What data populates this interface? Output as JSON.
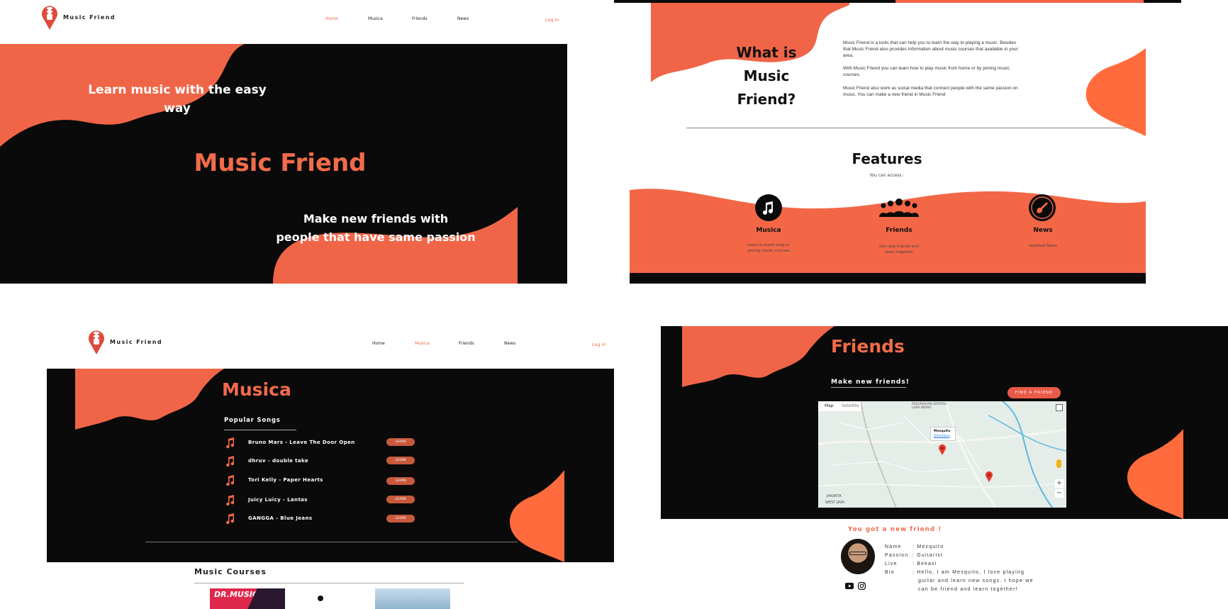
{
  "brand": {
    "name": "Music Friend"
  },
  "nav": {
    "home": "Home",
    "musica": "Musica",
    "friends": "Friends",
    "news": "News",
    "login": "Log In"
  },
  "hero": {
    "tagline1": "Learn music with the easy",
    "tagline1b": "way",
    "title": "Music Friend",
    "tagline2a": "Make new friends with",
    "tagline2b": "people that have same passion"
  },
  "about": {
    "heading_line1": "What is Music",
    "heading_line2": "Friend?",
    "p1": "Music Friend is a tools that can help you to learn the way to playing a music. Besides that Music Friend also provides information about music courses that available in your area.",
    "p2": "With Music Friend you can learn how to play music from home or by joining music courses.",
    "p3": "Music Friend also work as social media that connect people with the same passion on music. You can make a new friend in Music Friend"
  },
  "features": {
    "heading": "Features",
    "subheading": "You can access :",
    "items": [
      {
        "title": "Musica",
        "desc": "Learn a chord song or joining music courses",
        "icon": "music-note-icon"
      },
      {
        "title": "Friends",
        "desc": "Get new friends and learn together",
        "icon": "people-group-icon"
      },
      {
        "title": "News",
        "desc": "Updated News",
        "icon": "guitar-icon"
      }
    ]
  },
  "musica": {
    "title": "Musica",
    "popular_heading": "Popular Songs",
    "songs": [
      {
        "title": "Bruno Mars - Leave The Door Open",
        "button": "LEARN"
      },
      {
        "title": "dhruv - double take",
        "button": "LEARN"
      },
      {
        "title": "Tori Kelly - Paper Hearts",
        "button": "LEARN"
      },
      {
        "title": "Juicy Luicy - Lantas",
        "button": "LEARN"
      },
      {
        "title": "GANGGA - Blue Jeans",
        "button": "LEARN"
      }
    ],
    "courses_heading": "Music Courses",
    "course1_label": "DR.MUSIC"
  },
  "friends": {
    "title": "Friends",
    "subheading": "Make new friends!",
    "find_button": "FIND A FRIEND",
    "map": {
      "tab_map": "Map",
      "tab_satellite": "Satellite",
      "area_top": "PERUMAHAN SINTASA LUKA INDAH",
      "pin_name": "Mesquito",
      "pin_link": "Directions",
      "area_bottom": "JAKARTA",
      "area_bottom2": "WEST JAVA"
    },
    "result_heading": "You got a new friend !",
    "profile": {
      "name_key": "Name",
      "name_val": ": Mezquito",
      "passion_key": "Passion",
      "passion_val": ": Guitarist",
      "live_key": "Live",
      "live_val": ": Bekasi",
      "bio_key": "Bio",
      "bio_line1": ": Hello, I am Mesquito, I love playing",
      "bio_line2": "guitar and learn new songs. I hope we",
      "bio_line3": "can be friend and learn together!"
    }
  },
  "colors": {
    "accent": "#f26b4b",
    "dark": "#0a0a0a"
  }
}
